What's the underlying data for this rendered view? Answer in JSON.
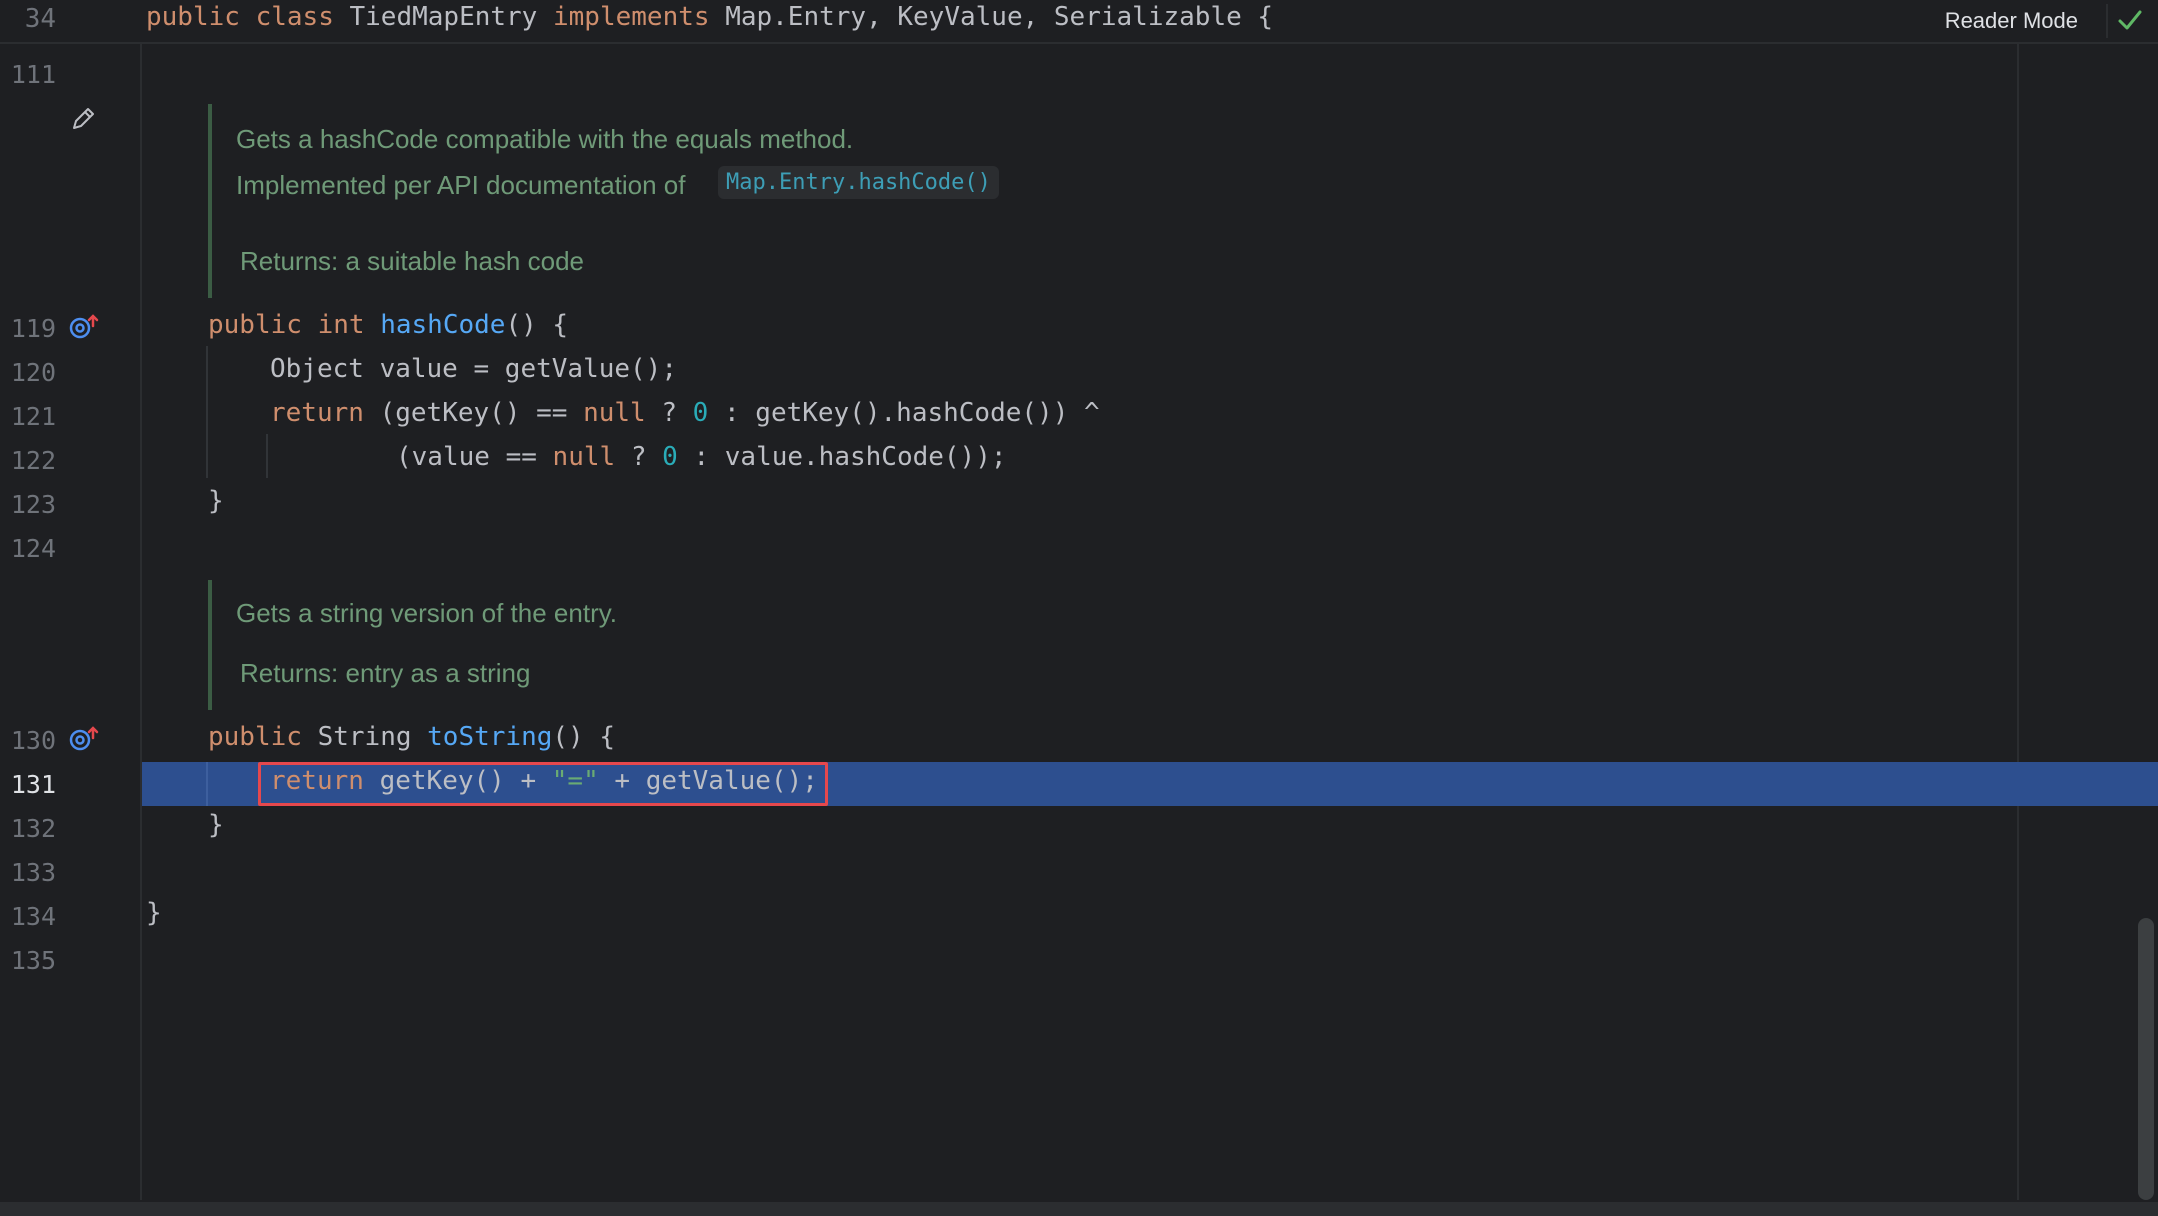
{
  "sticky": {
    "line_number": "34",
    "tokens": [
      {
        "t": "public ",
        "c": "kw"
      },
      {
        "t": "class ",
        "c": "kw"
      },
      {
        "t": "TiedMapEntry ",
        "c": "plain"
      },
      {
        "t": "implements ",
        "c": "kw"
      },
      {
        "t": "Map.Entry, KeyValue, Serializable {",
        "c": "plain"
      }
    ]
  },
  "toolbar": {
    "reader_mode_label": "Reader Mode"
  },
  "colors": {
    "background": "#1e1f22",
    "keyword": "#cf8e6d",
    "function": "#56a8f5",
    "number": "#2aacb8",
    "string": "#6aab73",
    "selection": "#2d4f8f",
    "highlight_box": "#e5484d"
  },
  "docs": [
    {
      "lines": [
        {
          "text": "Gets a hashCode compatible with the equals method."
        },
        {
          "text": "Implemented per API documentation of ",
          "link": "Map.Entry.hashCode()"
        },
        {
          "text": "Returns: a suitable hash code"
        }
      ]
    },
    {
      "lines": [
        {
          "text": "Gets a string version of the entry."
        },
        {
          "text": "Returns: entry as a string"
        }
      ]
    }
  ],
  "code": {
    "line_111": "111",
    "line_119": "119",
    "line_120": "120",
    "line_121": "121",
    "line_122": "122",
    "line_123": "123",
    "line_124": "124",
    "line_130": "130",
    "line_131": "131",
    "line_132": "132",
    "line_133": "133",
    "line_134": "134",
    "line_135": "135",
    "l119": [
      {
        "t": "public ",
        "c": "kw"
      },
      {
        "t": "int ",
        "c": "kw"
      },
      {
        "t": "hashCode",
        "c": "fn"
      },
      {
        "t": "() {",
        "c": "plain"
      }
    ],
    "l120": [
      {
        "t": "Object value = getValue();",
        "c": "plain"
      }
    ],
    "l121": [
      {
        "t": "return ",
        "c": "kw"
      },
      {
        "t": "(getKey() == ",
        "c": "plain"
      },
      {
        "t": "null",
        "c": "kw"
      },
      {
        "t": " ? ",
        "c": "plain"
      },
      {
        "t": "0",
        "c": "num"
      },
      {
        "t": " : getKey().hashCode()) ^",
        "c": "plain"
      }
    ],
    "l122": [
      {
        "t": "(value == ",
        "c": "plain"
      },
      {
        "t": "null",
        "c": "kw"
      },
      {
        "t": " ? ",
        "c": "plain"
      },
      {
        "t": "0",
        "c": "num"
      },
      {
        "t": " : value.hashCode());",
        "c": "plain"
      }
    ],
    "l123": [
      {
        "t": "}",
        "c": "plain"
      }
    ],
    "l130": [
      {
        "t": "public ",
        "c": "kw"
      },
      {
        "t": "String ",
        "c": "plain"
      },
      {
        "t": "toString",
        "c": "fn"
      },
      {
        "t": "() {",
        "c": "plain"
      }
    ],
    "l131": [
      {
        "t": "return ",
        "c": "kw"
      },
      {
        "t": "getKey() + ",
        "c": "plain"
      },
      {
        "t": "\"=\"",
        "c": "str"
      },
      {
        "t": " + getValue();",
        "c": "plain"
      }
    ],
    "l132": [
      {
        "t": "}",
        "c": "plain"
      }
    ],
    "l134": [
      {
        "t": "}",
        "c": "plain"
      }
    ]
  },
  "icons": {
    "edit": "pencil-icon",
    "override_119": "override-method-icon",
    "override_130": "override-method-icon",
    "status": "check-icon"
  }
}
